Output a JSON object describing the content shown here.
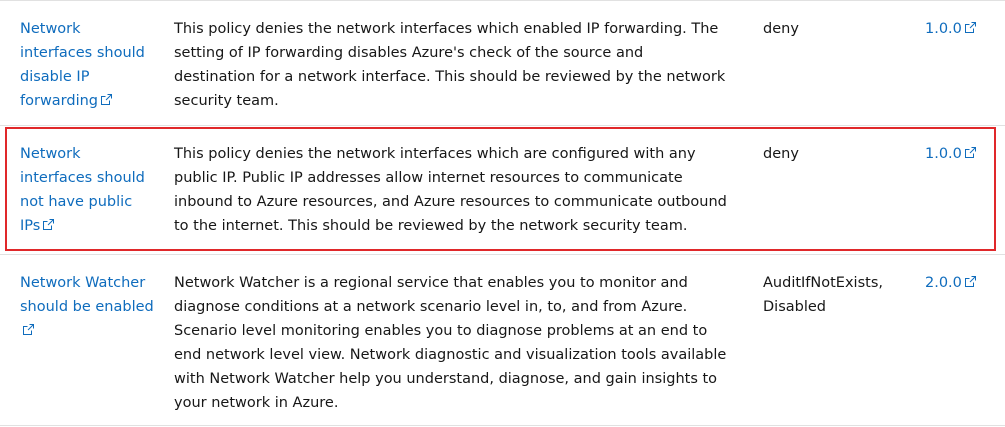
{
  "rows": [
    {
      "name": "Network interfaces should disable IP forwarding",
      "description": "This policy denies the network interfaces which enabled IP forwarding. The setting of IP forwarding disables Azure's check of the source and destination for a network interface. This should be reviewed by the network security team.",
      "effect": "deny",
      "version": "1.0.0"
    },
    {
      "name": "Network interfaces should not have public IPs",
      "description": "This policy denies the network interfaces which are configured with any public IP. Public IP addresses allow internet resources to communicate inbound to Azure resources, and Azure resources to communicate outbound to the internet. This should be reviewed by the network security team.",
      "effect": "deny",
      "version": "1.0.0"
    },
    {
      "name": "Network Watcher should be enabled",
      "description": "Network Watcher is a regional service that enables you to monitor and diagnose conditions at a network scenario level in, to, and from Azure. Scenario level monitoring enables you to diagnose problems at an end to end network level view. Network diagnostic and visualization tools available with Network Watcher help you understand, diagnose, and gain insights to your network in Azure.",
      "effect": "AuditIfNotExists, Disabled",
      "version": "2.0.0"
    }
  ],
  "icons": {
    "external_link": "external-link-icon"
  },
  "colors": {
    "link": "#0f6cbd",
    "highlight_border": "#e0282a",
    "divider": "#e1e1e1"
  }
}
